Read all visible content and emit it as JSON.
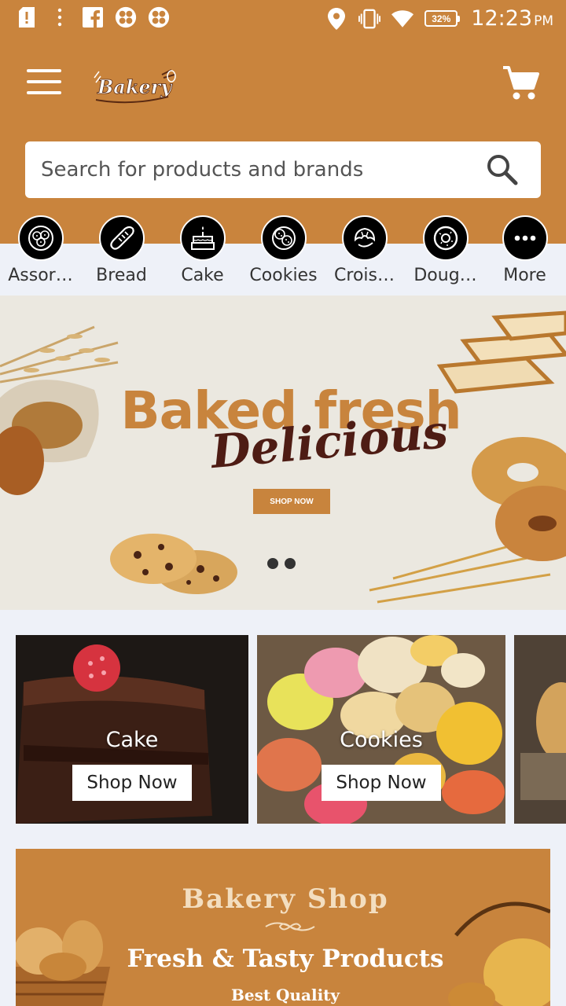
{
  "status_bar": {
    "time": "12:23",
    "ampm": "PM",
    "battery": "32%"
  },
  "header": {
    "logo_text": "Bakery"
  },
  "search": {
    "placeholder": "Search for products and brands"
  },
  "categories": [
    {
      "label": "Assor…",
      "icon": "cookie-plate-icon"
    },
    {
      "label": "Bread",
      "icon": "bread-icon"
    },
    {
      "label": "Cake",
      "icon": "cake-icon"
    },
    {
      "label": "Cookies",
      "icon": "cookies-icon"
    },
    {
      "label": "Crois…",
      "icon": "croissant-icon"
    },
    {
      "label": "Doug…",
      "icon": "donut-icon"
    },
    {
      "label": "More",
      "icon": "more-icon"
    }
  ],
  "banner": {
    "title": "Baked fresh",
    "script": "Delicious",
    "button": "SHOP NOW"
  },
  "promos": [
    {
      "label": "Cake",
      "button": "Shop Now"
    },
    {
      "label": "Cookies",
      "button": "Shop Now"
    }
  ],
  "bottom_banner": {
    "title": "Bakery Shop",
    "subtitle": "Fresh & Tasty Products",
    "tagline": "Best Quality"
  },
  "colors": {
    "brand": "#c9843d",
    "background": "#eef1f8",
    "script_text": "#4e1c14"
  }
}
